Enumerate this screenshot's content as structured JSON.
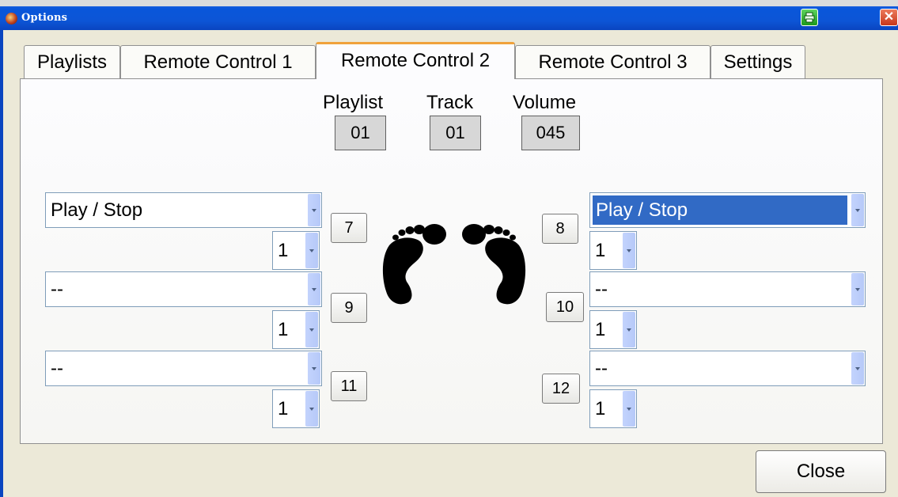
{
  "window": {
    "title": "Options"
  },
  "tabs": [
    {
      "label": "Playlists",
      "active": false
    },
    {
      "label": "Remote Control 1",
      "active": false
    },
    {
      "label": "Remote Control 2",
      "active": true
    },
    {
      "label": "Remote Control 3",
      "active": false
    },
    {
      "label": "Settings",
      "active": false
    }
  ],
  "status": {
    "playlist_label": "Playlist",
    "playlist_value": "01",
    "track_label": "Track",
    "track_value": "01",
    "volume_label": "Volume",
    "volume_value": "045"
  },
  "left_rows": [
    {
      "button": "7",
      "action": "Play / Stop",
      "count": "1"
    },
    {
      "button": "9",
      "action": "--",
      "count": "1"
    },
    {
      "button": "11",
      "action": "--",
      "count": "1"
    }
  ],
  "right_rows": [
    {
      "button": "8",
      "action": "Play / Stop",
      "count": "1",
      "selected": true
    },
    {
      "button": "10",
      "action": "--",
      "count": "1"
    },
    {
      "button": "12",
      "action": "--",
      "count": "1"
    }
  ],
  "icons": {
    "app": "app-icon",
    "printer": "printer-icon",
    "close": "close-icon",
    "feet": "footprints-icon"
  },
  "colors": {
    "titlebar": "#0a56da",
    "active_tab_accent": "#f0a23b",
    "selection": "#316ac5"
  },
  "footer": {
    "close_label": "Close"
  },
  "titlebar_close_glyph": "✕"
}
